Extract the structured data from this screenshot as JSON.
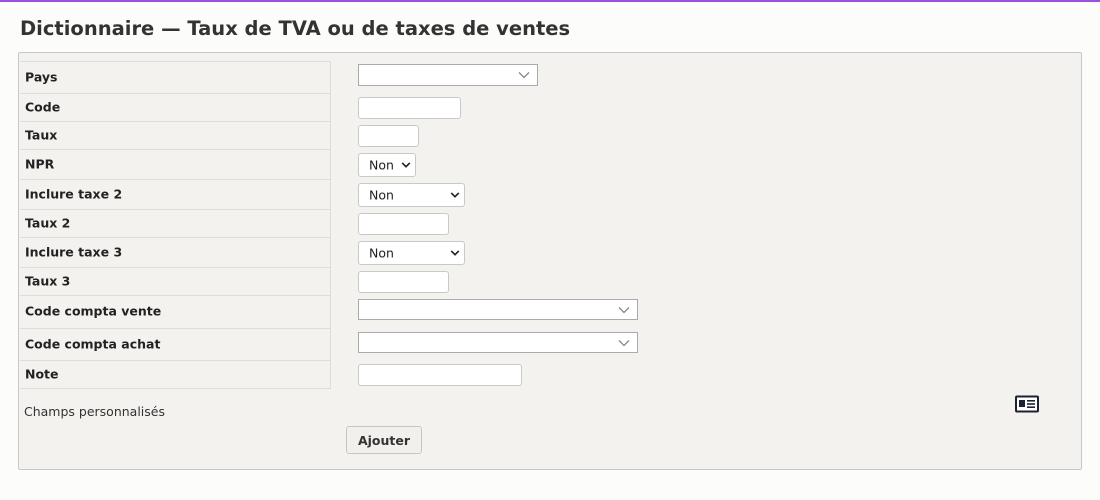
{
  "page": {
    "title": "Dictionnaire — Taux de TVA ou de taxes de ventes"
  },
  "form": {
    "fields": {
      "pays": {
        "label": "Pays",
        "value": ""
      },
      "code": {
        "label": "Code",
        "value": ""
      },
      "taux": {
        "label": "Taux",
        "value": ""
      },
      "npr": {
        "label": "NPR",
        "value": "Non"
      },
      "inclure_taxe_2": {
        "label": "Inclure taxe 2",
        "value": "Non"
      },
      "taux_2": {
        "label": "Taux 2",
        "value": ""
      },
      "inclure_taxe_3": {
        "label": "Inclure taxe 3",
        "value": "Non"
      },
      "taux_3": {
        "label": "Taux 3",
        "value": ""
      },
      "code_compta_vente": {
        "label": "Code compta vente",
        "value": ""
      },
      "code_compta_achat": {
        "label": "Code compta achat",
        "value": ""
      },
      "note": {
        "label": "Note",
        "value": ""
      }
    },
    "extra_fields_label": "Champs personnalisés",
    "extra_fields_icon": "card-icon",
    "submit_label": "Ajouter"
  },
  "colors": {
    "accent_bar": "#9b4fe0",
    "panel_bg": "#f3f2ef",
    "page_bg": "#fcfcfb"
  }
}
